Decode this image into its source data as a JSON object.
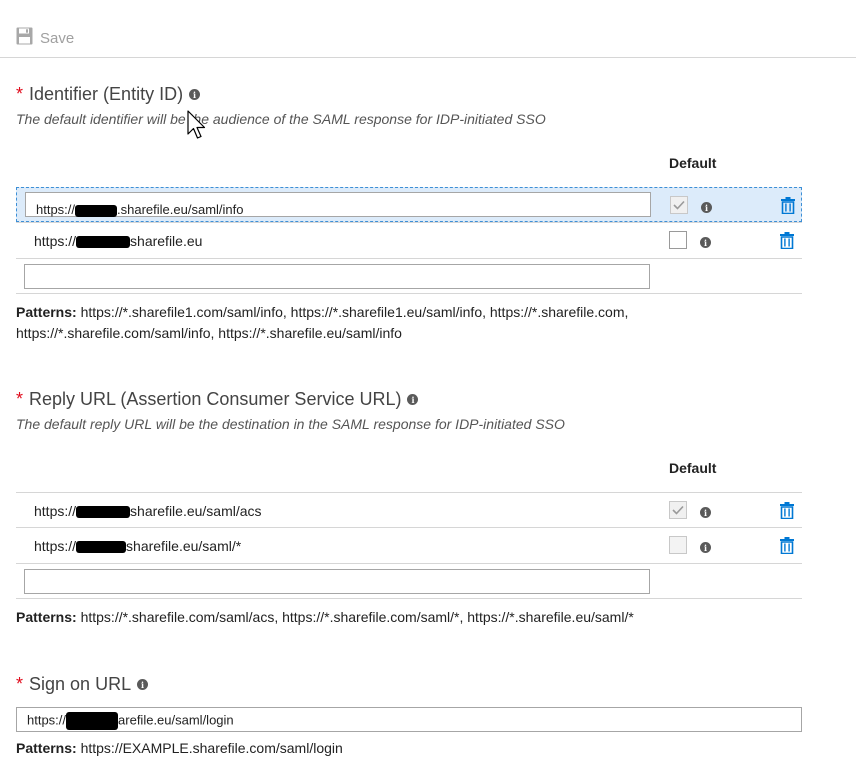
{
  "toolbar": {
    "save_label": "Save",
    "save_icon": "floppy-disk-icon"
  },
  "identifier": {
    "title": "Identifier (Entity ID)",
    "required_mark": "*",
    "description": "The default identifier will be the audience of the SAML response for IDP-initiated SSO",
    "default_header": "Default",
    "rows": [
      {
        "prefix": "https://",
        "suffix": ".sharefile.eu/saml/info",
        "default": true,
        "selected": true
      },
      {
        "prefix": "https://",
        "suffix": "sharefile.eu",
        "default": false,
        "selected": false
      }
    ],
    "patterns_label": "Patterns:",
    "patterns_line1": "https://*.sharefile1.com/saml/info, https://*.sharefile1.eu/saml/info, https://*.sharefile.com,",
    "patterns_line2": "https://*.sharefile.com/saml/info, https://*.sharefile.eu/saml/info"
  },
  "reply": {
    "title": "Reply URL (Assertion Consumer Service URL)",
    "required_mark": "*",
    "description": "The default reply URL will be the destination in the SAML response for IDP-initiated SSO",
    "default_header": "Default",
    "rows": [
      {
        "prefix": "https://",
        "suffix": "sharefile.eu/saml/acs",
        "default": true
      },
      {
        "prefix": "https://",
        "suffix": "sharefile.eu/saml/*",
        "default": false
      }
    ],
    "patterns_label": "Patterns:",
    "patterns_text": "https://*.sharefile.com/saml/acs, https://*.sharefile.com/saml/*, https://*.sharefile.eu/saml/*"
  },
  "signon": {
    "title": "Sign on URL",
    "required_mark": "*",
    "value_prefix": "https://",
    "value_suffix": "arefile.eu/saml/login",
    "patterns_label": "Patterns:",
    "patterns_text": "https://EXAMPLE.sharefile.com/saml/login"
  },
  "colors": {
    "accent": "#0078d4",
    "required": "#e00b1c",
    "selected_row": "#dcebfa"
  }
}
